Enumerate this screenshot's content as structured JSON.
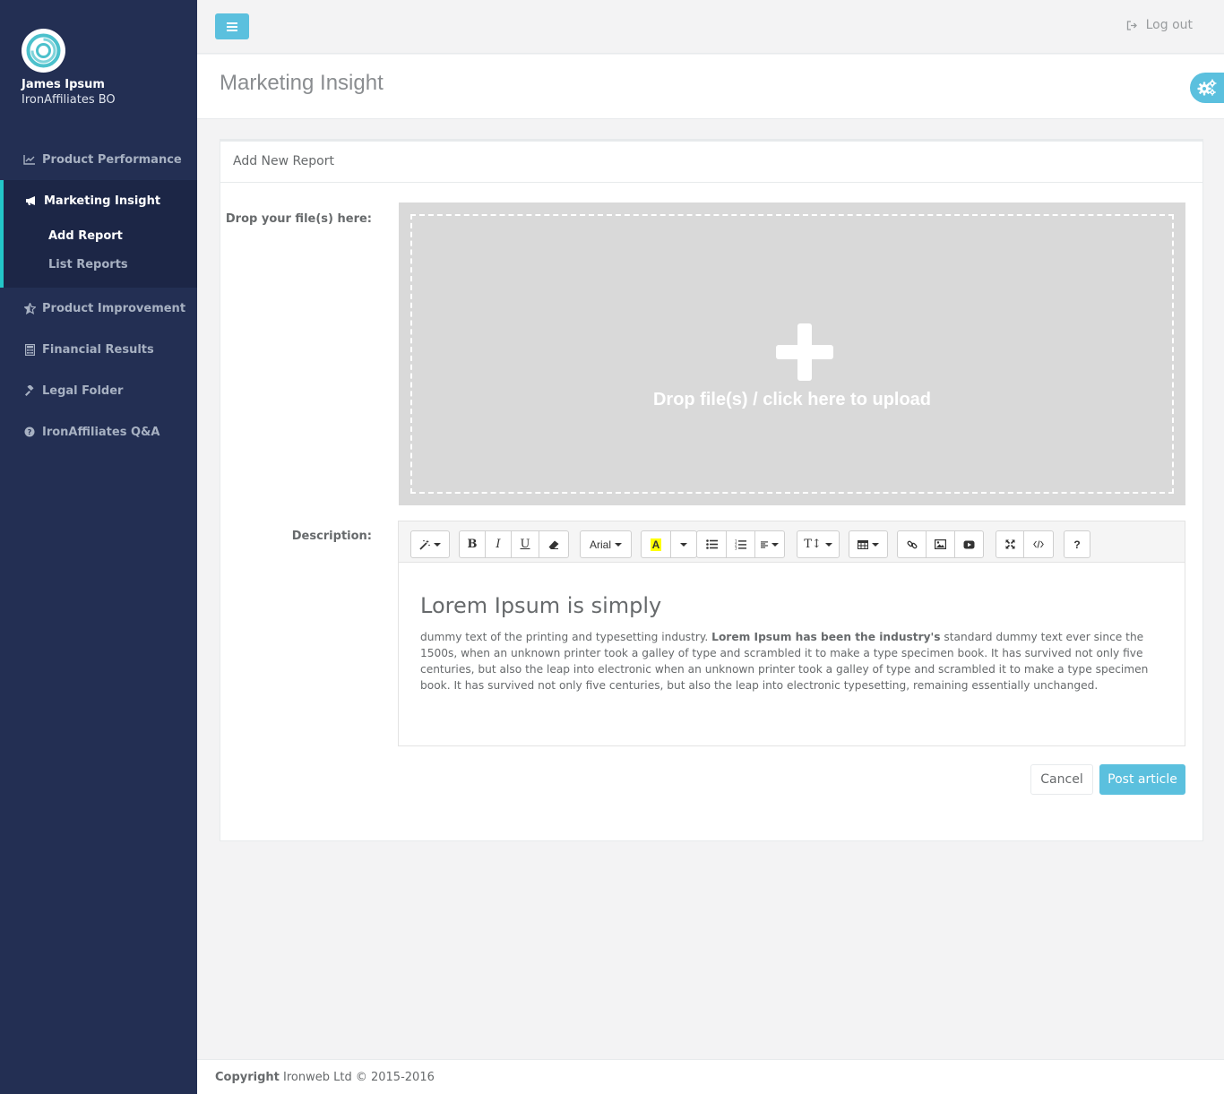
{
  "user": {
    "name": "James Ipsum",
    "org": "IronAffiliates BO"
  },
  "sidebar": {
    "items": [
      {
        "label": "Product Performance",
        "icon": "line-chart-icon"
      },
      {
        "label": "Marketing Insight",
        "icon": "bullhorn-icon",
        "active": true,
        "children": [
          {
            "label": "Add Report",
            "current": true
          },
          {
            "label": "List Reports"
          }
        ]
      },
      {
        "label": "Product Improvement",
        "icon": "star-half-icon"
      },
      {
        "label": "Financial Results",
        "icon": "calculator-icon"
      },
      {
        "label": "Legal Folder",
        "icon": "gavel-icon"
      },
      {
        "label": "IronAffiliates Q&A",
        "icon": "question-circle-icon"
      }
    ]
  },
  "topbar": {
    "logout_label": "Log out",
    "menu_icon": "bars-icon",
    "logout_icon": "sign-out-icon"
  },
  "page": {
    "title": "Marketing Insight"
  },
  "card": {
    "title": "Add New Report",
    "drop_label": "Drop your file(s) here:",
    "drop_text": "Drop file(s) / click here to upload",
    "description_label": "Description:"
  },
  "editor": {
    "font_name": "Arial",
    "highlight_letter": "A",
    "text_size_label": "T↕",
    "help_label": "?",
    "heading": "Lorem Ipsum is simply",
    "p_before": "dummy text of the printing and typesetting industry. ",
    "p_bold": "Lorem Ipsum has been the industry's",
    "p_after": " standard dummy text ever since the 1500s, when an unknown printer took a galley of type and scrambled it to make a type specimen book. It has survived not only five centuries, but also the leap into electronic when an unknown printer took a galley of type and scrambled it to make a type specimen book. It has survived not only five centuries, but also the leap into electronic typesetting, remaining essentially unchanged."
  },
  "actions": {
    "cancel_label": "Cancel",
    "post_label": "Post article"
  },
  "footer": {
    "copyright_label": "Copyright",
    "copyright_text": " Ironweb Ltd © 2015-2016"
  },
  "colors": {
    "sidebar": "#232f53",
    "accent": "#5bc0de",
    "active_border": "#23c6c8"
  }
}
